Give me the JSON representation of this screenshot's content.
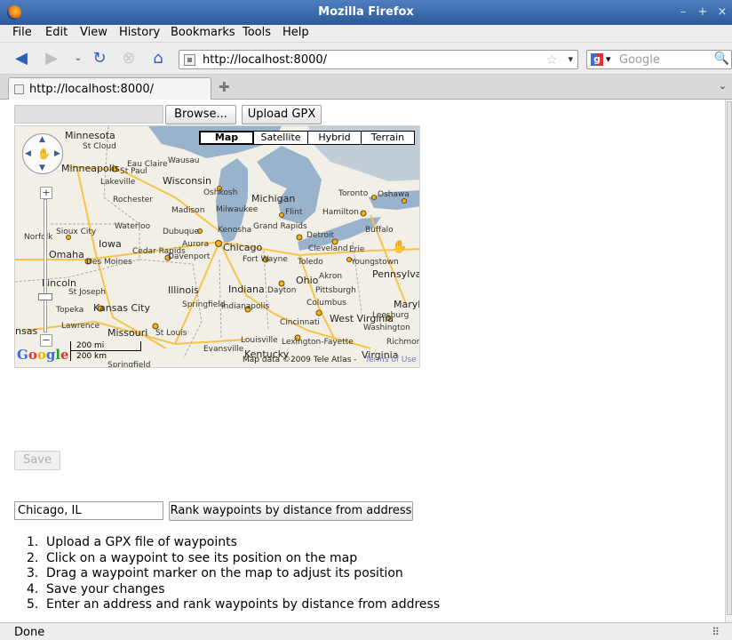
{
  "window": {
    "title": "Mozilla Firefox"
  },
  "menu": [
    {
      "label": "File"
    },
    {
      "label": "Edit"
    },
    {
      "label": "View"
    },
    {
      "label": "History"
    },
    {
      "label": "Bookmarks"
    },
    {
      "label": "Tools"
    },
    {
      "label": "Help"
    }
  ],
  "nav": {
    "url": "http://localhost:8000/",
    "search_placeholder": "Google",
    "search_engine_icon": "google-g-icon"
  },
  "tabs": [
    {
      "label": "http://localhost:8000/"
    }
  ],
  "upload": {
    "browse_label": "Browse...",
    "upload_label": "Upload GPX"
  },
  "map": {
    "types": [
      {
        "label": "Map"
      },
      {
        "label": "Satellite"
      },
      {
        "label": "Hybrid"
      },
      {
        "label": "Terrain"
      }
    ],
    "selected_type": "Map",
    "labels": {
      "minnesota": "Minnesota",
      "st_cloud": "St Cloud",
      "minneapolis": "Minneapolis",
      "st_paul": "St Paul",
      "eau_claire": "Eau Claire",
      "wausau": "Wausau",
      "lakeville": "Lakeville",
      "wisconsin": "Wisconsin",
      "rochester": "Rochester",
      "oshkosh": "Oshkosh",
      "michigan": "Michigan",
      "toronto": "Toronto",
      "oshawa": "Oshawa",
      "madison": "Madison",
      "milwaukee": "Milwaukee",
      "flint": "Flint",
      "hamilton": "Hamilton",
      "norfolk": "Norfolk",
      "waterloo": "Waterloo",
      "sioux_city": "Sioux City",
      "dubuque": "Dubuque",
      "kenosha": "Kenosha",
      "grand_rapids": "Grand Rapids",
      "detroit": "Detroit",
      "buffalo": "Buffalo",
      "iowa": "Iowa",
      "cedar_rapids": "Cedar Rapids",
      "aurora": "Aurora",
      "chicago": "Chicago",
      "omaha": "Omaha",
      "des_moines": "Des Moines",
      "davenport": "Davenport",
      "fort_wayne": "Fort Wayne",
      "toledo": "Toledo",
      "cleveland": "Cleveland",
      "erie": "Erie",
      "youngstown": "Youngstown",
      "pennsylvania": "Pennsylvania",
      "lincoln": "Lincoln",
      "ohio": "Ohio",
      "akron": "Akron",
      "st_joseph": "St Joseph",
      "illinois": "Illinois",
      "indiana": "Indiana",
      "dayton": "Dayton",
      "pittsburgh": "Pittsburgh",
      "topeka": "Topeka",
      "kansas_city": "Kansas City",
      "springfield": "Springfield",
      "indianapolis": "Indianapolis",
      "columbus": "Columbus",
      "maryland": "Maryland",
      "cincinnati": "Cincinnati",
      "west_virginia": "West Virginia",
      "leesburg": "Leesburg",
      "washington": "Washington",
      "lawrence": "Lawrence",
      "missouri": "Missouri",
      "st_louis": "St Louis",
      "kansas": "nsas",
      "louisville": "Louisville",
      "lexington": "Lexington-Fayette",
      "richmond": "Richmond",
      "evansville": "Evansville",
      "kentucky": "Kentucky",
      "virginia": "Virginia",
      "springfield_mo": "Springfield"
    },
    "scale_mi": "200 mi",
    "scale_km": "200 km",
    "logo": "Google",
    "attribution": "Map data ©2009 Tele Atlas -",
    "terms": "Terms of Use"
  },
  "save_label": "Save",
  "address": {
    "value": "Chicago, IL",
    "rank_label": "Rank waypoints by distance from address"
  },
  "steps": [
    "Upload a GPX file of waypoints",
    "Click on a waypoint to see its position on the map",
    "Drag a waypoint marker on the map to adjust its position",
    "Save your changes",
    "Enter an address and rank waypoints by distance from address"
  ],
  "status": "Done",
  "colors": {
    "titlebar": "#2b5a99",
    "map_land": "#f2efe6",
    "map_water": "#99b3cc",
    "highway": "#f7c34a"
  }
}
